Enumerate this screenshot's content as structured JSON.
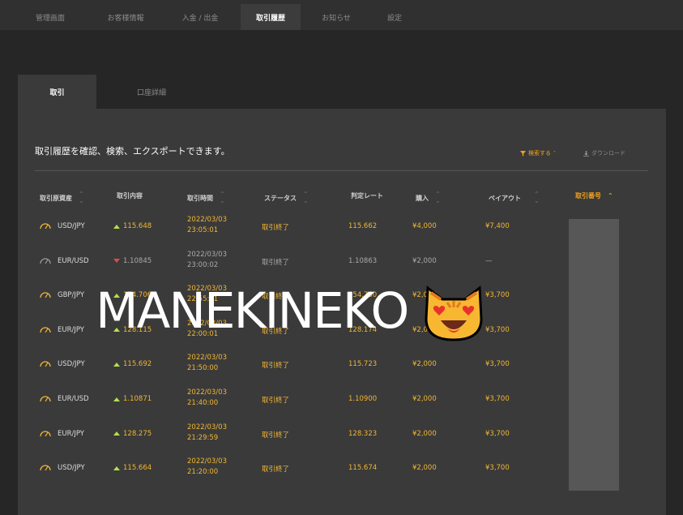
{
  "topnav": {
    "tabs": [
      {
        "label": "管理画面"
      },
      {
        "label": "お客様情報"
      },
      {
        "label": "入金 / 出金"
      },
      {
        "label": "取引履歴"
      },
      {
        "label": "お知らせ"
      },
      {
        "label": "設定"
      }
    ],
    "active_tab": "取引履歴"
  },
  "panel_tabs": [
    {
      "label": "取引"
    },
    {
      "label": "口座詳細"
    }
  ],
  "description": "取引履歴を確認、検索、エクスポートできます。",
  "actions": {
    "search_label": "検索する",
    "download_label": "ダウンロード"
  },
  "table": {
    "headers": [
      "取引原資産",
      "取引内容",
      "取引時間",
      "ステータス",
      "判定レート",
      "購入",
      "ペイアウト",
      "取引番号"
    ],
    "rows": [
      {
        "asset": "USD/JPY",
        "direction": "up",
        "rate": "115.648",
        "date": "2022/03/03",
        "time": "23:05:01",
        "status": "取引終了",
        "judge_rate": "115.662",
        "purchase": "¥4,000",
        "payout": "¥7,400",
        "active": true
      },
      {
        "asset": "EUR/USD",
        "direction": "down",
        "rate": "1.10845",
        "date": "2022/03/03",
        "time": "23:00:02",
        "status": "取引終了",
        "judge_rate": "1.10863",
        "purchase": "¥2,000",
        "payout": "—",
        "active": false
      },
      {
        "asset": "GBP/JPY",
        "direction": "up",
        "rate": "154.706",
        "date": "2022/03/03",
        "time": "22:55:01",
        "status": "取引終了",
        "judge_rate": "154.730",
        "purchase": "¥2,000",
        "payout": "¥3,700",
        "active": true
      },
      {
        "asset": "EUR/JPY",
        "direction": "up",
        "rate": "128.115",
        "date": "2022/03/03",
        "time": "22:00:01",
        "status": "取引終了",
        "judge_rate": "128.174",
        "purchase": "¥2,000",
        "payout": "¥3,700",
        "active": true
      },
      {
        "asset": "USD/JPY",
        "direction": "up",
        "rate": "115.692",
        "date": "2022/03/03",
        "time": "21:50:00",
        "status": "取引終了",
        "judge_rate": "115.723",
        "purchase": "¥2,000",
        "payout": "¥3,700",
        "active": true
      },
      {
        "asset": "EUR/USD",
        "direction": "up",
        "rate": "1.10871",
        "date": "2022/03/03",
        "time": "21:40:00",
        "status": "取引終了",
        "judge_rate": "1.10900",
        "purchase": "¥2,000",
        "payout": "¥3,700",
        "active": true
      },
      {
        "asset": "EUR/JPY",
        "direction": "up",
        "rate": "128.275",
        "date": "2022/03/03",
        "time": "21:29:59",
        "status": "取引終了",
        "judge_rate": "128.323",
        "purchase": "¥2,000",
        "payout": "¥3,700",
        "active": true
      },
      {
        "asset": "USD/JPY",
        "direction": "up",
        "rate": "115.664",
        "date": "2022/03/03",
        "time": "21:20:00",
        "status": "取引終了",
        "judge_rate": "115.674",
        "purchase": "¥2,000",
        "payout": "¥3,700",
        "active": true
      }
    ]
  },
  "overlay_text": "MANEKINEKO",
  "colors": {
    "accent": "#f2b634",
    "up_arrow": "#b5e04a",
    "down_arrow": "#e04a4a",
    "id_column": "#575757"
  },
  "icons": [
    "gauge-icon",
    "up-arrow-icon",
    "down-arrow-icon",
    "filter-icon",
    "download-icon",
    "sort-icon",
    "cat-emoji-icon"
  ]
}
